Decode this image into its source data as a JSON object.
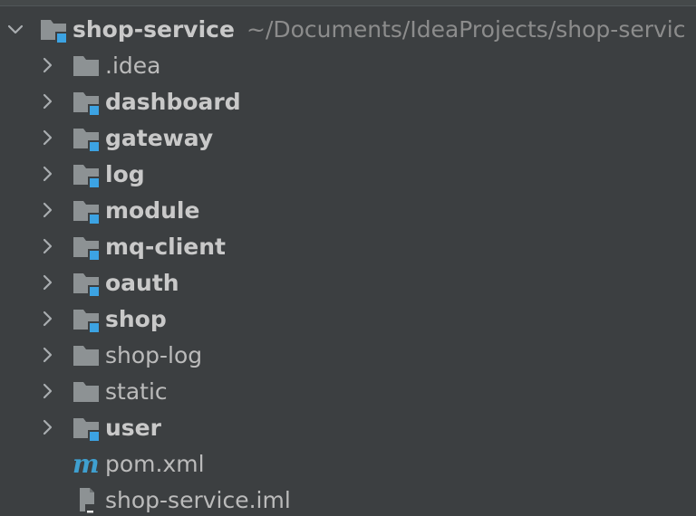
{
  "project": {
    "name": "shop-service",
    "path": "~/Documents/IdeaProjects/shop-servic"
  },
  "tree": [
    {
      "label": ".idea",
      "kind": "folder",
      "bold": false,
      "expandable": true
    },
    {
      "label": "dashboard",
      "kind": "module",
      "bold": true,
      "expandable": true
    },
    {
      "label": "gateway",
      "kind": "module",
      "bold": true,
      "expandable": true
    },
    {
      "label": "log",
      "kind": "module",
      "bold": true,
      "expandable": true
    },
    {
      "label": "module",
      "kind": "module",
      "bold": true,
      "expandable": true
    },
    {
      "label": "mq-client",
      "kind": "module",
      "bold": true,
      "expandable": true
    },
    {
      "label": "oauth",
      "kind": "module",
      "bold": true,
      "expandable": true
    },
    {
      "label": "shop",
      "kind": "module",
      "bold": true,
      "expandable": true
    },
    {
      "label": "shop-log",
      "kind": "folder",
      "bold": false,
      "expandable": true
    },
    {
      "label": "static",
      "kind": "folder",
      "bold": false,
      "expandable": true
    },
    {
      "label": "user",
      "kind": "module",
      "bold": true,
      "expandable": true
    },
    {
      "label": "pom.xml",
      "kind": "maven",
      "bold": false,
      "expandable": false
    },
    {
      "label": "shop-service.iml",
      "kind": "iml",
      "bold": false,
      "expandable": false
    }
  ],
  "colors": {
    "background": "#3c3f41",
    "folder": "#8d9294",
    "module_badge": "#3ca3e3",
    "maven": "#3fa0d0",
    "text": "#bbbbbb",
    "path_text": "#8c8c8c"
  }
}
